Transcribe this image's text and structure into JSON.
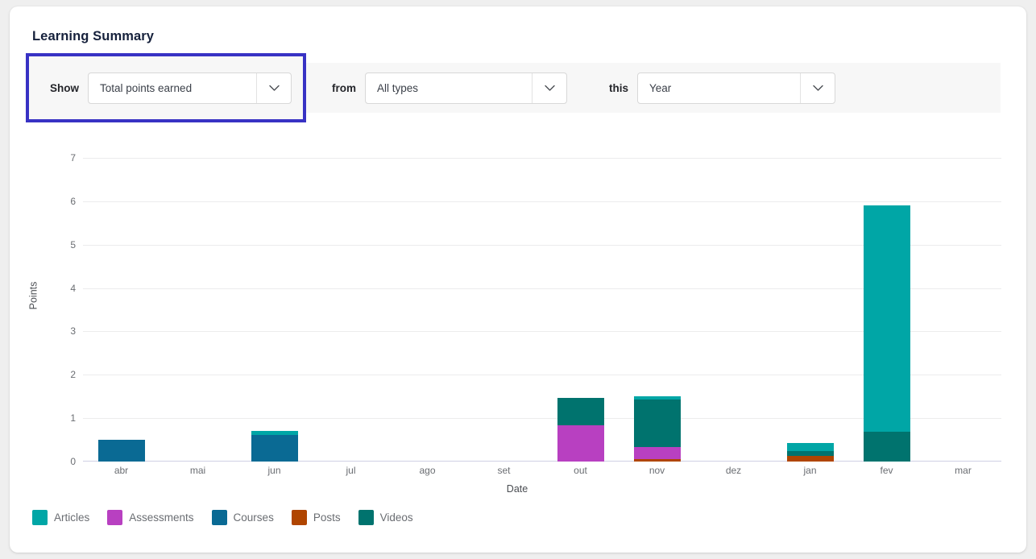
{
  "card": {
    "title": "Learning Summary"
  },
  "toolbar": {
    "filters": [
      {
        "label": "Show",
        "value": "Total points earned",
        "chevron_icon": "chevron-down-icon",
        "focused": true
      },
      {
        "label": "from",
        "value": "All types",
        "chevron_icon": "chevron-down-icon",
        "focused": false
      },
      {
        "label": "this",
        "value": "Year",
        "chevron_icon": "chevron-down-icon",
        "focused": false
      }
    ],
    "focus_ring_color": "#3832c4"
  },
  "chart_data": {
    "type": "bar",
    "stacked": true,
    "title": "Learning Summary",
    "xlabel": "Date",
    "ylabel": "Points",
    "ylim": [
      0,
      7
    ],
    "yticks": [
      0,
      1,
      2,
      3,
      4,
      5,
      6,
      7
    ],
    "grid": true,
    "legend_position": "bottom-left",
    "categories": [
      "abr",
      "mai",
      "jun",
      "jul",
      "ago",
      "set",
      "out",
      "nov",
      "dez",
      "jan",
      "fev",
      "mar"
    ],
    "series": [
      {
        "name": "Articles",
        "color": "#00a6a6",
        "values": [
          0,
          0,
          0.08,
          0,
          0,
          0,
          0,
          0.07,
          0,
          0.17,
          5.22,
          0
        ]
      },
      {
        "name": "Assessments",
        "color": "#b840c1",
        "values": [
          0,
          0,
          0,
          0,
          0,
          0,
          0.83,
          0.28,
          0,
          0,
          0,
          0
        ]
      },
      {
        "name": "Courses",
        "color": "#0a6a94",
        "values": [
          0.5,
          0,
          0.62,
          0,
          0,
          0,
          0,
          0,
          0,
          0,
          0,
          0
        ]
      },
      {
        "name": "Posts",
        "color": "#b04500",
        "values": [
          0,
          0,
          0,
          0,
          0,
          0,
          0,
          0.05,
          0,
          0.13,
          0,
          0
        ]
      },
      {
        "name": "Videos",
        "color": "#00736e",
        "values": [
          0,
          0,
          0,
          0,
          0,
          0,
          0.64,
          1.1,
          0,
          0.12,
          0.68,
          0
        ]
      }
    ],
    "stack_order": [
      "Posts",
      "Assessments",
      "Courses",
      "Videos",
      "Articles"
    ],
    "totals": [
      0.5,
      0,
      0.7,
      0,
      0,
      0,
      1.47,
      1.5,
      0,
      0.42,
      5.9,
      0
    ]
  },
  "legend": {
    "items": [
      {
        "label": "Articles",
        "color": "#00a6a6"
      },
      {
        "label": "Assessments",
        "color": "#b840c1"
      },
      {
        "label": "Courses",
        "color": "#0a6a94"
      },
      {
        "label": "Posts",
        "color": "#b04500"
      },
      {
        "label": "Videos",
        "color": "#00736e"
      }
    ]
  }
}
